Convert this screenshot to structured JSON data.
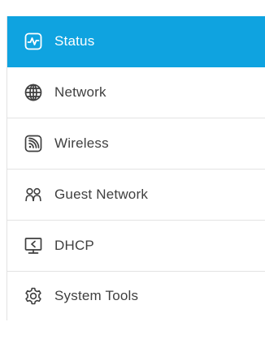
{
  "colors": {
    "accent": "#0fa3e0",
    "text": "#3f3f3f",
    "active_text": "#ffffff"
  },
  "sidebar": {
    "items": [
      {
        "label": "Status",
        "icon": "status-icon",
        "active": true
      },
      {
        "label": "Network",
        "icon": "globe-icon",
        "active": false
      },
      {
        "label": "Wireless",
        "icon": "wireless-icon",
        "active": false
      },
      {
        "label": "Guest Network",
        "icon": "guest-users-icon",
        "active": false
      },
      {
        "label": "DHCP",
        "icon": "dhcp-monitor-icon",
        "active": false
      },
      {
        "label": "System Tools",
        "icon": "gear-icon",
        "active": false
      }
    ]
  }
}
